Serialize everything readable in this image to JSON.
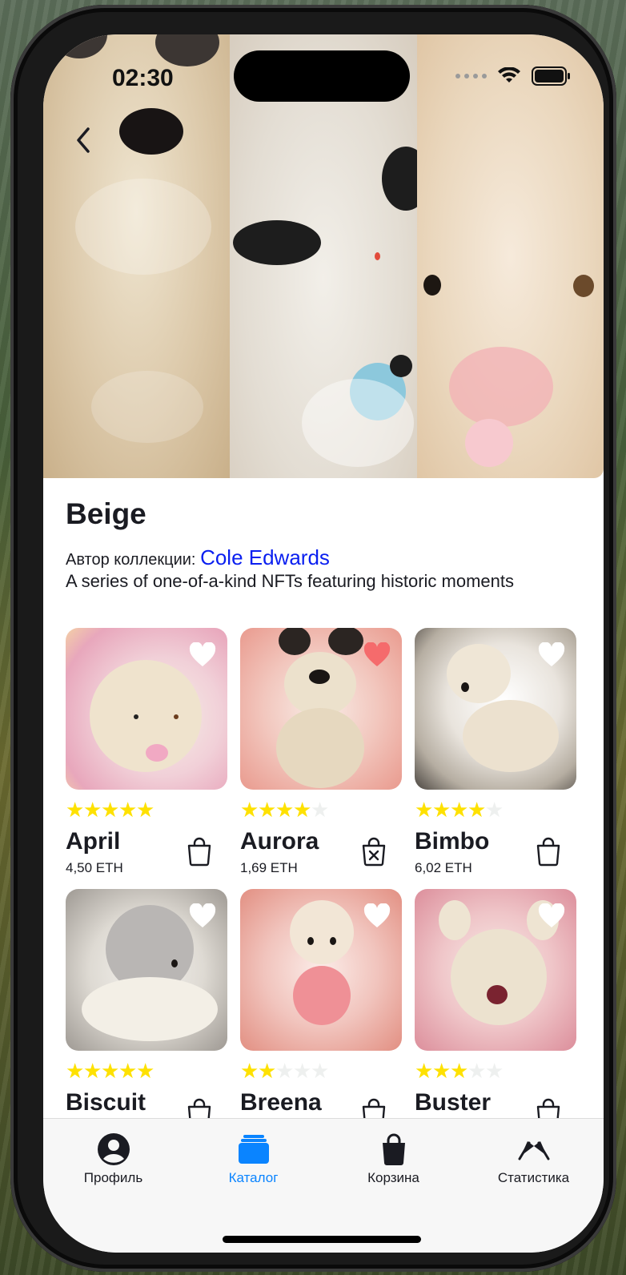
{
  "status_bar": {
    "time": "02:30"
  },
  "collection": {
    "title": "Beige",
    "author_prefix": "Автор коллекции:",
    "author_name": "Cole Edwards",
    "description": "A series of one-of-a-kind NFTs featuring historic moments"
  },
  "nfts": [
    {
      "name": "April",
      "price": "4,50 ETH",
      "rating": 5,
      "liked": false,
      "in_cart": false
    },
    {
      "name": "Aurora",
      "price": "1,69 ETH",
      "rating": 4,
      "liked": true,
      "in_cart": true
    },
    {
      "name": "Bimbo",
      "price": "6,02 ETH",
      "rating": 4,
      "liked": false,
      "in_cart": false
    },
    {
      "name": "Biscuit",
      "price": "",
      "rating": 5,
      "liked": false,
      "in_cart": false
    },
    {
      "name": "Breena",
      "price": "",
      "rating": 2,
      "liked": false,
      "in_cart": false
    },
    {
      "name": "Buster",
      "price": "",
      "rating": 3,
      "liked": false,
      "in_cart": false
    }
  ],
  "tabs": [
    {
      "label": "Профиль",
      "icon": "profile-icon",
      "active": false
    },
    {
      "label": "Каталог",
      "icon": "catalog-icon",
      "active": true
    },
    {
      "label": "Корзина",
      "icon": "cart-icon",
      "active": false
    },
    {
      "label": "Статистика",
      "icon": "statistics-icon",
      "active": false
    }
  ],
  "colors": {
    "accent": "#0a84ff",
    "link": "#0a1ff0",
    "star_on": "#fee100",
    "star_off": "#eef0ef",
    "like_active": "#f56b6c",
    "text": "#1a1b22"
  }
}
